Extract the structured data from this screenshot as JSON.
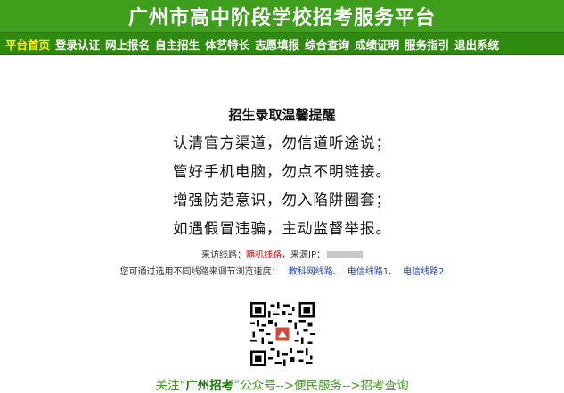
{
  "header": {
    "title": "广州市高中阶段学校招考服务平台"
  },
  "nav": {
    "items": [
      "平台首页",
      "登录认证",
      "网上报名",
      "自主招生",
      "体艺特长",
      "志愿填报",
      "综合查询",
      "成绩证明",
      "服务指引",
      "退出系统"
    ]
  },
  "notice": {
    "title": "招生录取温馨提醒",
    "lines": [
      "认清官方渠道，勿信道听途说；",
      "管好手机电脑，勿点不明链接。",
      "增强防范意识，勿入陷阱圈套；",
      "如遇假冒违骗，主动监督举报。"
    ]
  },
  "visit": {
    "label": "来访线路：",
    "random": "随机线路",
    "ip_label": "，来源IP："
  },
  "switch": {
    "label": "您可通过选用不同线路来调节浏览速度：",
    "routes": [
      "教科网线路",
      "电信线路1",
      "电信线路2"
    ],
    "sep": "、"
  },
  "follow": {
    "prefix": "关注“",
    "brand": "广州招考",
    "suffix": "”公众号-->便民服务-->招考查询"
  },
  "colors": {
    "header_bg": "#3f9f1d",
    "nav_bg": "#2f8a10",
    "active": "#fff200",
    "link": "#1a3fd6",
    "alert": "#e00000"
  }
}
